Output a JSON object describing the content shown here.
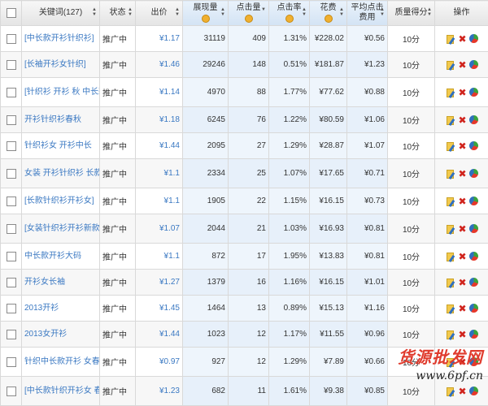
{
  "header": {
    "keyword": "关键词(127)",
    "status": "状态",
    "bid": "出价",
    "impressions": "展现量",
    "clicks": "点击量",
    "ctr": "点击率",
    "cost": "花费",
    "avg_cpc": "平均点击费用",
    "quality": "质量得分",
    "ops": "操作"
  },
  "rows": [
    {
      "keyword": "[中长款开衫针织衫]",
      "status": "推广中",
      "bid": "¥1.17",
      "impressions": "31119",
      "clicks": "409",
      "ctr": "1.31%",
      "cost": "¥228.02",
      "avg_cpc": "¥0.56",
      "quality": "10分"
    },
    {
      "keyword": "[长袖开衫女针织]",
      "status": "推广中",
      "bid": "¥1.46",
      "impressions": "29246",
      "clicks": "148",
      "ctr": "0.51%",
      "cost": "¥181.87",
      "avg_cpc": "¥1.23",
      "quality": "10分"
    },
    {
      "keyword": "[针织衫 开衫 秋 中长款]",
      "status": "推广中",
      "bid": "¥1.14",
      "impressions": "4970",
      "clicks": "88",
      "ctr": "1.77%",
      "cost": "¥77.62",
      "avg_cpc": "¥0.88",
      "quality": "10分"
    },
    {
      "keyword": "开衫针织衫春秋",
      "status": "推广中",
      "bid": "¥1.18",
      "impressions": "6245",
      "clicks": "76",
      "ctr": "1.22%",
      "cost": "¥80.59",
      "avg_cpc": "¥1.06",
      "quality": "10分"
    },
    {
      "keyword": "针织衫女 开衫中长",
      "status": "推广中",
      "bid": "¥1.44",
      "impressions": "2095",
      "clicks": "27",
      "ctr": "1.29%",
      "cost": "¥28.87",
      "avg_cpc": "¥1.07",
      "quality": "10分"
    },
    {
      "keyword": "女装 开衫针织衫 长款",
      "status": "推广中",
      "bid": "¥1.1",
      "impressions": "2334",
      "clicks": "25",
      "ctr": "1.07%",
      "cost": "¥17.65",
      "avg_cpc": "¥0.71",
      "quality": "10分"
    },
    {
      "keyword": "[长款针织衫开衫女]",
      "status": "推广中",
      "bid": "¥1.1",
      "impressions": "1905",
      "clicks": "22",
      "ctr": "1.15%",
      "cost": "¥16.15",
      "avg_cpc": "¥0.73",
      "quality": "10分"
    },
    {
      "keyword": "[女装针织衫开衫新款]",
      "status": "推广中",
      "bid": "¥1.07",
      "impressions": "2044",
      "clicks": "21",
      "ctr": "1.03%",
      "cost": "¥16.93",
      "avg_cpc": "¥0.81",
      "quality": "10分"
    },
    {
      "keyword": "中长款开衫大码",
      "status": "推广中",
      "bid": "¥1.1",
      "impressions": "872",
      "clicks": "17",
      "ctr": "1.95%",
      "cost": "¥13.83",
      "avg_cpc": "¥0.81",
      "quality": "10分"
    },
    {
      "keyword": "开衫女长袖",
      "status": "推广中",
      "bid": "¥1.27",
      "impressions": "1379",
      "clicks": "16",
      "ctr": "1.16%",
      "cost": "¥16.15",
      "avg_cpc": "¥1.01",
      "quality": "10分"
    },
    {
      "keyword": "2013开衫",
      "status": "推广中",
      "bid": "¥1.45",
      "impressions": "1464",
      "clicks": "13",
      "ctr": "0.89%",
      "cost": "¥15.13",
      "avg_cpc": "¥1.16",
      "quality": "10分"
    },
    {
      "keyword": "2013女开衫",
      "status": "推广中",
      "bid": "¥1.44",
      "impressions": "1023",
      "clicks": "12",
      "ctr": "1.17%",
      "cost": "¥11.55",
      "avg_cpc": "¥0.96",
      "quality": "10分"
    },
    {
      "keyword": "针织中长款开衫 女春秋",
      "status": "推广中",
      "bid": "¥0.97",
      "impressions": "927",
      "clicks": "12",
      "ctr": "1.29%",
      "cost": "¥7.89",
      "avg_cpc": "¥0.66",
      "quality": "10分"
    },
    {
      "keyword": "[中长款针织开衫女 春秋]",
      "status": "推广中",
      "bid": "¥1.23",
      "impressions": "682",
      "clicks": "11",
      "ctr": "1.61%",
      "cost": "¥9.38",
      "avg_cpc": "¥0.85",
      "quality": "10分"
    }
  ],
  "watermark": {
    "line1": "货源批发网",
    "line2": "www.6pf.cn"
  },
  "icons": [
    "checkbox",
    "sort-arrows-icon",
    "help-circle-icon",
    "edit-pencil-icon",
    "delete-x-icon",
    "report-chart-icon"
  ],
  "colors": {
    "link": "#3a78c2",
    "delete": "#d0241d",
    "metric_column_bg": "#eef5fc"
  }
}
